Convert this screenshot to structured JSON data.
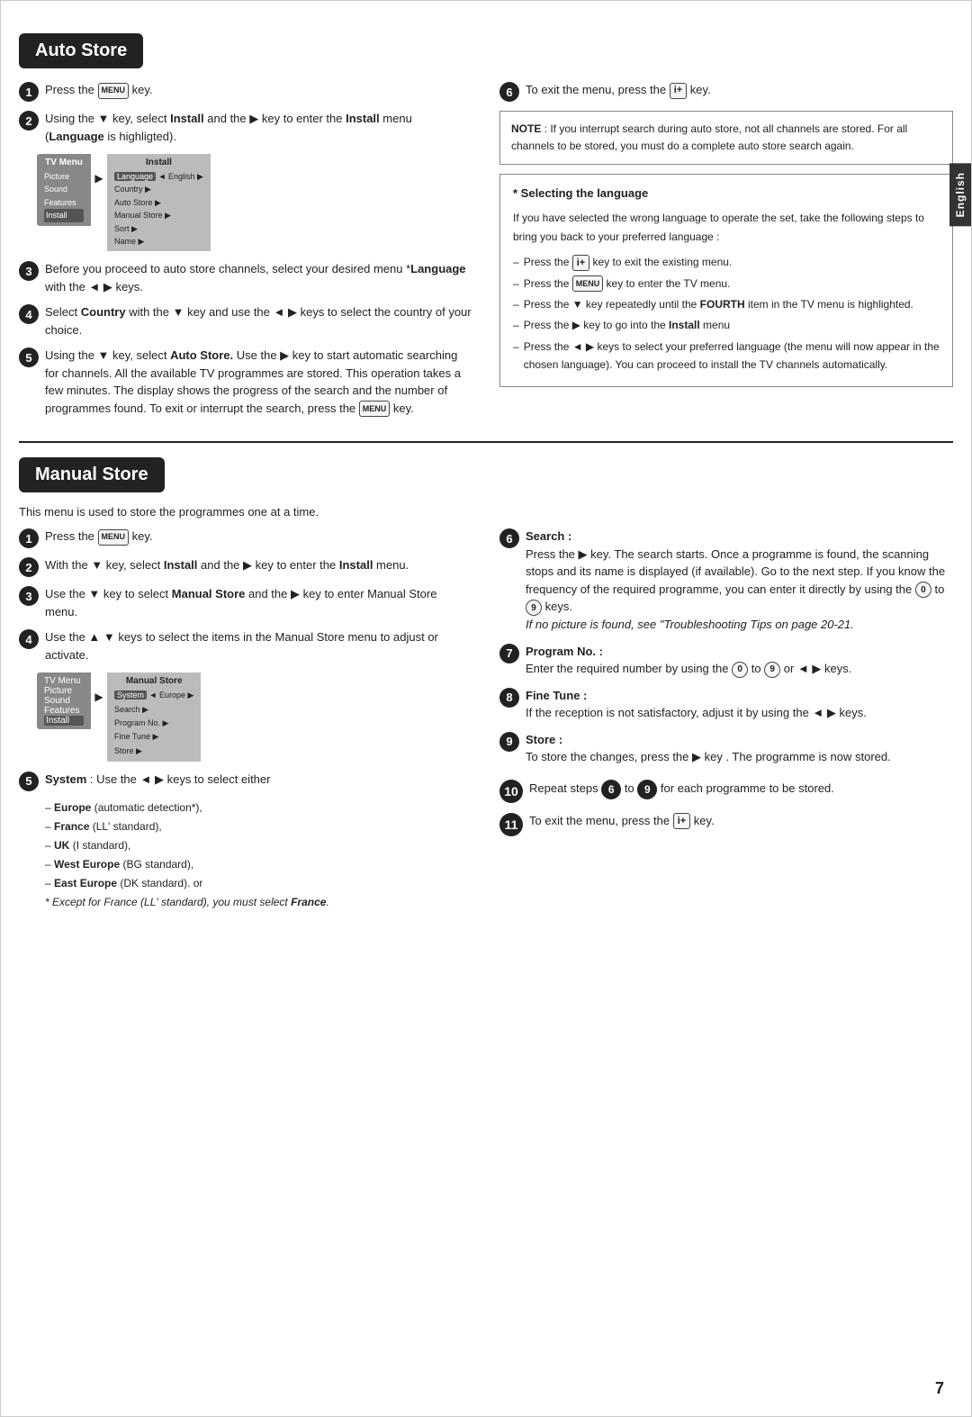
{
  "page": {
    "number": "7",
    "english_tab": "English"
  },
  "auto_store": {
    "title": "Auto Store",
    "intro": "",
    "steps": [
      {
        "num": "1",
        "text": "Press the",
        "key": "MENU",
        "suffix": "key."
      },
      {
        "num": "2",
        "text": "Using the ▼ key, select Install and the ▶ key to enter the Install menu (Language is highligted)."
      },
      {
        "num": "3",
        "text": "Before you proceed to auto store channels, select your desired menu *Language with the ◄ ▶ keys."
      },
      {
        "num": "4",
        "text": "Select Country with the ▼ key and use the ◄ ▶ keys to select the country of your choice."
      },
      {
        "num": "5",
        "text": "Using the ▼ key, select Auto Store. Use the ▶ key to start automatic searching for channels. All the available TV programmes are stored. This operation takes a few minutes. The display shows the progress of the search and the number of programmes found. To exit or interrupt the search, press the",
        "key_suffix": "MENU",
        "end": "key."
      }
    ],
    "right_steps": [
      {
        "num": "6",
        "text": "To exit the menu, press the",
        "key": "i+",
        "suffix": "key."
      }
    ],
    "note": {
      "title": "NOTE",
      "text": ": If you interrupt search during auto store, not all channels are stored. For all channels to be stored, you must do a complete auto store search again."
    },
    "select_lang": {
      "title": "* Selecting the language",
      "intro": "If you have selected the wrong language to operate the set, take the following steps to bring you back to your preferred language :",
      "items": [
        {
          "text": "Press the",
          "key": "i+",
          "suffix": "key to exit the existing menu."
        },
        {
          "text": "Press the",
          "key": "MENU",
          "suffix": "key to enter the TV menu."
        },
        {
          "text": "Press the ▼ key repeatedly until the FOURTH item in the TV menu is highlighted."
        },
        {
          "text": "Press the ▶ key to go into the Install menu"
        },
        {
          "text": "Press the ◄ ▶ keys to select your preferred language (the menu will now appear in the chosen language). You can proceed to install the TV channels automatically."
        }
      ]
    },
    "tv_menu": {
      "outer_title": "TV Menu",
      "outer_items": [
        "Picture",
        "Sound",
        "Features",
        "Install"
      ],
      "inner_title": "Install",
      "inner_items": [
        "Language",
        "Country",
        "Auto Store",
        "Manual Store",
        "Sort",
        "Name"
      ],
      "highlighted": "Language",
      "value": "English"
    }
  },
  "manual_store": {
    "title": "Manual Store",
    "intro": "This menu is used to store the programmes one at a time.",
    "steps": [
      {
        "num": "1",
        "text": "Press the",
        "key": "MENU",
        "suffix": "key."
      },
      {
        "num": "2",
        "text": "With the ▼ key, select Install and the ▶ key to enter the Install menu."
      },
      {
        "num": "3",
        "text": "Use the ▼ key to select Manual Store and the ▶ key to enter Manual Store menu."
      },
      {
        "num": "4",
        "text": "Use the ▲ ▼ keys to select the items in the Manual Store menu to adjust or activate."
      }
    ],
    "system_note": {
      "prefix": "System",
      "text": ": Use the ◄ ▶ keys to select either"
    },
    "system_items": [
      {
        "label": "Europe",
        "detail": "(automatic detection*),"
      },
      {
        "label": "France",
        "detail": "(LL' standard),"
      },
      {
        "label": "UK",
        "detail": "(I standard),"
      },
      {
        "label": "West Europe",
        "detail": "(BG standard),"
      },
      {
        "label": "East Europe",
        "detail": "(DK standard). or"
      }
    ],
    "system_footnote": "* Except for France (LL' standard), you must select France.",
    "ms_menu": {
      "outer_title": "TV Menu",
      "outer_items": [
        "Picture",
        "Sound",
        "Features",
        "Install"
      ],
      "inner_title": "Manual Store",
      "inner_items": [
        "System",
        "Search",
        "Program No.",
        "Fine Tune",
        "Store"
      ],
      "highlighted": "System",
      "value": "Europe"
    },
    "right_steps": [
      {
        "num": "6",
        "label": "Search",
        "text": "Press the ▶ key. The search starts. Once a programme is found, the scanning stops and its name is displayed (if available). Go to the next step. If you know the frequency of the required programme, you can enter it directly by using the",
        "key1": "0",
        "mid": "to",
        "key2": "9",
        "suffix": "keys.",
        "italic": "If no picture is found, see \"Troubleshooting Tips on page 20-21."
      },
      {
        "num": "7",
        "label": "Program No.",
        "text": "Enter the required number by using the",
        "key1": "0",
        "mid": "to",
        "key2": "9",
        "suffix2": "or ◄ ▶ keys."
      },
      {
        "num": "8",
        "label": "Fine Tune",
        "text": "If the reception is not satisfactory, adjust it by using the ◄ ▶ keys."
      },
      {
        "num": "9",
        "label": "Store",
        "text": "To store the changes, press the ▶ key . The programme is now stored."
      }
    ],
    "repeat_step": {
      "num": "10",
      "text": "Repeat steps",
      "from": "6",
      "to": "9",
      "suffix": "for each programme to be stored."
    },
    "exit_step": {
      "num": "11",
      "text": "To exit the menu, press the",
      "key": "i+",
      "suffix": "key."
    }
  }
}
